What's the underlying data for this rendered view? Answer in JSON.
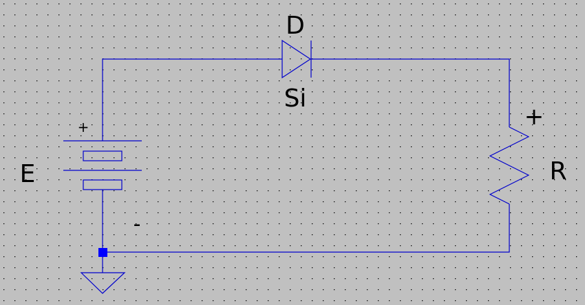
{
  "colors": {
    "background": "#c0c0c0",
    "grid_dot": "#000000",
    "wire": "#0000cc",
    "junction": "#0000ff",
    "label": "#000000"
  },
  "components": {
    "diode": {
      "ref": "D",
      "value": "Si",
      "icon": "diode-symbol"
    },
    "battery": {
      "ref": "E",
      "plus_mark": "+",
      "minus_mark": "-",
      "icon": "battery-symbol"
    },
    "resistor": {
      "ref": "R",
      "plus_mark": "+",
      "icon": "resistor-zigzag-symbol"
    },
    "ground": {
      "icon": "ground-symbol"
    }
  }
}
